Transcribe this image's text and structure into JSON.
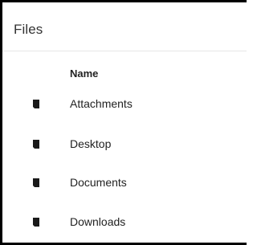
{
  "panel": {
    "title": "Files"
  },
  "table": {
    "column_header": "Name",
    "rows": [
      {
        "name": "Attachments",
        "icon": "folder-icon"
      },
      {
        "name": "Desktop",
        "icon": "folder-icon"
      },
      {
        "name": "Documents",
        "icon": "folder-icon"
      },
      {
        "name": "Downloads",
        "icon": "folder-icon"
      }
    ]
  },
  "colors": {
    "text": "#222222",
    "icon": "#1a1a1a",
    "border": "#000000"
  }
}
